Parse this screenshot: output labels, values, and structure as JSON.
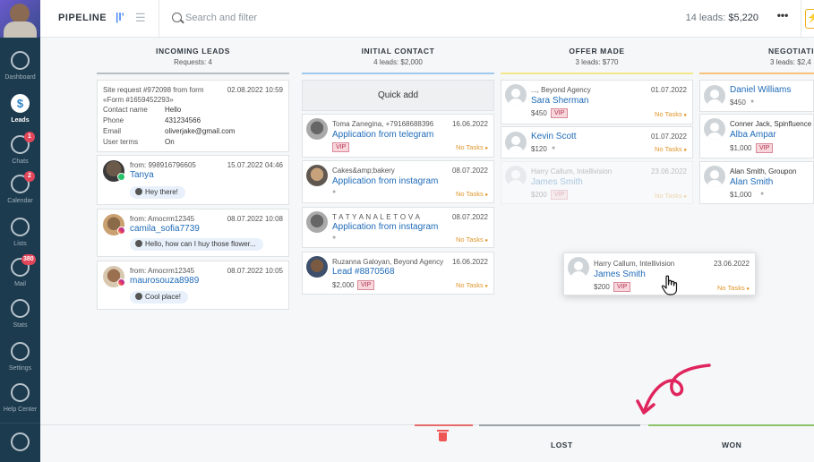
{
  "sidebar": {
    "items": [
      {
        "label": "Dashboard",
        "icon": "dashboard-icon",
        "badge": ""
      },
      {
        "label": "Leads",
        "icon": "leads-icon",
        "badge": ""
      },
      {
        "label": "Chats",
        "icon": "chats-icon",
        "badge": "1"
      },
      {
        "label": "Calendar",
        "icon": "calendar-icon",
        "badge": "2"
      },
      {
        "label": "Lists",
        "icon": "lists-icon",
        "badge": ""
      },
      {
        "label": "Mail",
        "icon": "mail-icon",
        "badge": "380"
      },
      {
        "label": "Stats",
        "icon": "stats-icon",
        "badge": ""
      },
      {
        "label": "Settings",
        "icon": "settings-icon",
        "badge": ""
      },
      {
        "label": "Help Center",
        "icon": "help-icon",
        "badge": ""
      }
    ]
  },
  "topbar": {
    "title": "PIPELINE",
    "search_placeholder": "Search and filter",
    "leads_count": "14 leads:",
    "leads_total": "$5,220",
    "more_label": "•••"
  },
  "columns": [
    {
      "title": "INCOMING LEADS",
      "sub": "Requests: 4",
      "color": "#b9bec3"
    },
    {
      "title": "INITIAL CONTACT",
      "sub": "4 leads: $2,000",
      "color": "#9fc9ef"
    },
    {
      "title": "OFFER MADE",
      "sub": "3 leads: $770",
      "color": "#f2e88a"
    },
    {
      "title": "NEGOTIATIO",
      "sub": "3 leads: $2,4",
      "color": "#f7c27a"
    }
  ],
  "incoming": {
    "form": {
      "line1": "Site request #972098 from form",
      "date": "02.08.2022 10:59",
      "line2": "«Form #1659452293»",
      "fields": [
        {
          "k": "Contact name",
          "v": "Hello"
        },
        {
          "k": "Phone",
          "v": "431234566"
        },
        {
          "k": "Email",
          "v": "oliverjake@gmail.com"
        },
        {
          "k": "User terms",
          "v": "On"
        }
      ]
    },
    "chats": [
      {
        "from": "from: 998916796605",
        "date": "15.07.2022 04:46",
        "name": "Tanya",
        "msg": "Hey there!"
      },
      {
        "from": "from: Amocrm12345",
        "date": "08.07.2022 10:08",
        "name": "camila_sofia7739",
        "msg": "Hello, how can I huy those flower..."
      },
      {
        "from": "from: Amocrm12345",
        "date": "08.07.2022 10:05",
        "name": "maurosouza8989",
        "msg": "Cool place!"
      }
    ]
  },
  "initial": {
    "quick_add": "Quick add",
    "cards": [
      {
        "contact": "Toma Zanegina, +79168688396",
        "date": "16.06.2022",
        "title": "Application from telegram",
        "vip": "VIP",
        "price": "",
        "tasks": "No Tasks"
      },
      {
        "contact": "Cakes&amp;bakery",
        "date": "08.07.2022",
        "title": "Application from instagram",
        "vip": "",
        "price": "",
        "tasks": "No Tasks"
      },
      {
        "contact": "T A T Y A N A L E T O V A",
        "date": "08.07.2022",
        "title": "Application from instagram",
        "vip": "",
        "price": "",
        "tasks": "No Tasks"
      },
      {
        "contact": "Ruzanna Galoyan, Beyond Agency",
        "date": "16.06.2022",
        "title": "Lead #8870568",
        "vip": "VIP",
        "price": "$2,000",
        "tasks": "No Tasks"
      }
    ]
  },
  "offer": {
    "cards": [
      {
        "contact": "..., Beyond Agency",
        "date": "01.07.2022",
        "title": "Sara Sherman",
        "vip": "VIP",
        "price": "$450",
        "tasks": "No Tasks"
      },
      {
        "contact": "",
        "date": "01.07.2022",
        "title": "Kevin Scott",
        "vip": "",
        "price": "$120",
        "tasks": "No Tasks"
      },
      {
        "contact": "Harry Callum, Intellivision",
        "date": "23.06.2022",
        "title": "James Smith",
        "vip": "VIP",
        "price": "$200",
        "tasks": "No Tasks"
      }
    ]
  },
  "dragging": {
    "contact": "Harry Callum, Intellivision",
    "date": "23.06.2022",
    "title": "James Smith",
    "vip": "VIP",
    "price": "$200",
    "tasks": "No Tasks"
  },
  "negotiation": {
    "cards": [
      {
        "contact": "",
        "title": "Daniel Williams",
        "price": "$450"
      },
      {
        "contact": "Conner Jack, Spinfluence",
        "title": "Alba Ampar",
        "price": "$1,000",
        "vip": "VIP"
      },
      {
        "contact": "Alan Smith, Groupon",
        "title": "Alan Smith",
        "price": "$1,000"
      }
    ]
  },
  "bottom": {
    "lost": "LOST",
    "won": "WON"
  },
  "colors": {
    "sidebar": "#1d3b4f",
    "link": "#1f6bb8",
    "accent": "#4c8bf5",
    "tasks": "#e0962a",
    "arrow": "#e0245e"
  }
}
